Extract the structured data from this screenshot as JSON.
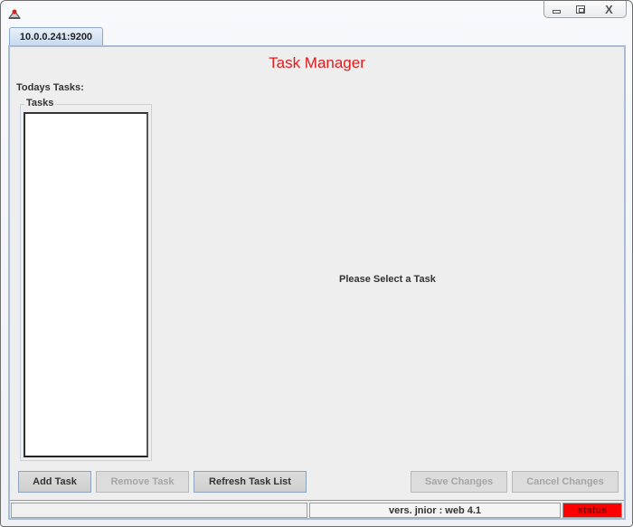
{
  "window": {
    "icon": "java-app-icon",
    "controls": {
      "minimize": "minimize-icon",
      "maximize": "maximize-icon",
      "close": "close-icon",
      "close_glyph": "X"
    }
  },
  "tabs": [
    {
      "label": "10.0.0.241:9200",
      "active": true
    }
  ],
  "main": {
    "title": "Task Manager",
    "title_color": "#e01b1b",
    "todays_label": "Todays Tasks:",
    "tasks_group_label": "Tasks",
    "tasks": [],
    "placeholder": "Please Select a Task"
  },
  "buttons": {
    "add_task": {
      "label": "Add Task",
      "enabled": true
    },
    "remove_task": {
      "label": "Remove Task",
      "enabled": false
    },
    "refresh_task_list": {
      "label": "Refresh Task List",
      "enabled": true
    },
    "save_changes": {
      "label": "Save Changes",
      "enabled": false
    },
    "cancel_changes": {
      "label": "Cancel Changes",
      "enabled": false
    }
  },
  "status_bar": {
    "message": "",
    "version": "vers. jnior  : web 4.1",
    "status": "status",
    "status_color": "#ff0000"
  }
}
